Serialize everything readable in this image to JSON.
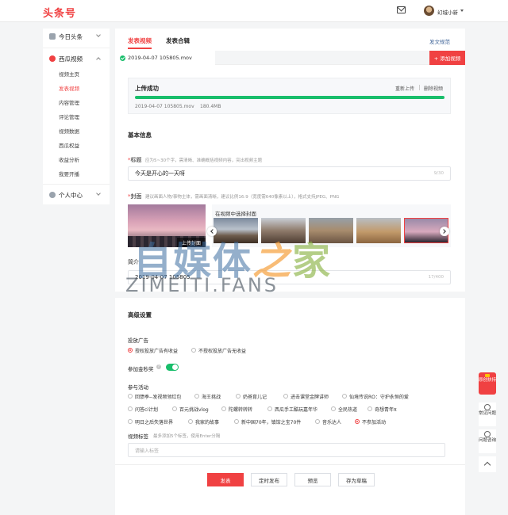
{
  "header": {
    "logo": "头条号",
    "username": "幻城小新"
  },
  "sidebar": {
    "groups": [
      {
        "label": "今日头条"
      },
      {
        "label": "西瓜视频"
      },
      {
        "label": "个人中心"
      }
    ],
    "items": [
      "视频主页",
      "发表视频",
      "内容管理",
      "评论管理",
      "视频数据",
      "西瓜权益",
      "收益分析",
      "我要开播"
    ],
    "active_item": "发表视频"
  },
  "main": {
    "tabs": [
      "发表视频",
      "发表合辑"
    ],
    "rules_link": "发文规范",
    "file_tab_name": "2019-04-07 105805.mov",
    "add_video_button": "+ 添加视频",
    "upload": {
      "status": "上传成功",
      "reupload": "重新上传",
      "delete": "删除视频",
      "file_name": "2019-04-07 105805.mov",
      "file_size": "180.4MB",
      "progress": 1.0
    },
    "basic_info_title": "基本信息",
    "title_field": {
      "required_mark": "*",
      "label": "标题",
      "hint": "应为5~30个字，需清晰、准确概括视频内容，突出视频主题",
      "value": "今天是开心的一天呀",
      "counter": "9/30"
    },
    "cover_field": {
      "required_mark": "*",
      "label": "封面",
      "hint": "建议画面人物/事物主体，需画面清晰，建议比例16:9（宽度需640像素以上），格式支持JPEG、PNG",
      "upload_cover_button": "上传封面",
      "picker_title": "在视频中选择封面"
    },
    "intro_field": {
      "label": "简介",
      "value": "2019-04-07 105805",
      "counter": "17/400"
    },
    "advanced_title": "高级设置",
    "ads": {
      "label": "投放广告",
      "options": [
        "授权投放广告有收益",
        "不授权投放广告无收益"
      ],
      "selected": "授权投放广告有收益"
    },
    "gold_award": {
      "label": "参加金秒奖",
      "help": "?",
      "enabled": true
    },
    "activities": {
      "label": "参与活动",
      "options": [
        "回馈季--发视频领红包",
        "海王挑战",
        "奶爸育儿记",
        "进击课堂金牌讲师",
        "仙境传说RO：守护永恒的爱",
        "问答ci计划",
        "百元挑战vlog",
        "陀螺转转转",
        "西瓜手工酷玩嘉年华",
        "全民热道",
        "奇想青年π",
        "明日之后失落世界",
        "我家的故事",
        "新中国70年，镇馆之宝70件",
        "音乐达人",
        "不参加活动"
      ],
      "selected": "不参加活动"
    },
    "tags": {
      "label": "视频标签",
      "hint": "最多添加5个标签，使用Enter分隔",
      "placeholder": "请输入标签"
    },
    "footer": {
      "publish": "发表",
      "schedule": "定时发布",
      "preview": "预览",
      "save_draft": "存为草稿"
    }
  },
  "float_panel": {
    "badge": "原创扶持",
    "faq": "常见问题",
    "consult": "问题咨询"
  },
  "watermark": {
    "cn_main": "自媒体",
    "cn_zhi": "之",
    "cn_jia": "家",
    "en": "ZIMEITI.FANS"
  },
  "colors": {
    "brand_red": "#f04142",
    "success_green": "#19be6b",
    "link_blue": "#406599"
  }
}
